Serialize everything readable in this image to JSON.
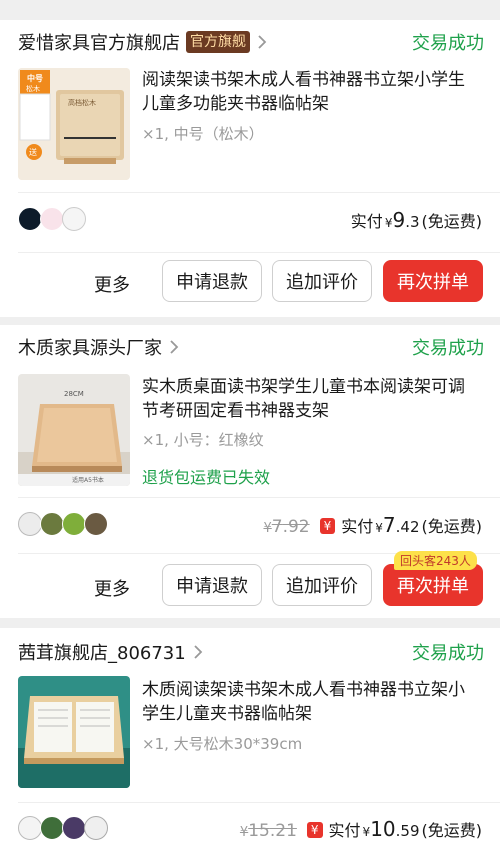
{
  "orders": [
    {
      "shop_name": "爱惜家具官方旗舰店",
      "shop_badge": "官方旗舰",
      "status": "交易成功",
      "product_title": "阅读架读书架木成人看书神器书立架小学生儿童多功能夹书器临帖架",
      "spec": "×1,  中号（松木）",
      "paid_label": "实付",
      "paid_yen": "¥",
      "paid_int": "9",
      "paid_dec": ".3",
      "paid_free": "(免运费)",
      "thumb_texts": [
        "中号",
        "松木",
        "送",
        "高档松木"
      ],
      "actions": {
        "more": "更多",
        "refund": "申请退款",
        "review": "追加评价",
        "rebuy": "再次拼单"
      }
    },
    {
      "shop_name": "木质家具源头厂家",
      "status": "交易成功",
      "product_title": "实木质桌面读书架学生儿童书本阅读架可调节考研固定看书神器支架",
      "spec": "×1,  小号：红橡纹",
      "note": "退货包运费已失效",
      "old_yen": "¥",
      "old_int": "7",
      "old_dec": ".92",
      "yen_badge": "¥",
      "paid_label": "实付",
      "paid_yen": "¥",
      "paid_int": "7",
      "paid_dec": ".42",
      "paid_free": "(免运费)",
      "thumb_texts": [
        "28CM",
        "适用A5书本"
      ],
      "tip": "回头客243人",
      "actions": {
        "more": "更多",
        "refund": "申请退款",
        "review": "追加评价",
        "rebuy": "再次拼单"
      }
    },
    {
      "shop_name": "茜茸旗舰店_806731",
      "status": "交易成功",
      "product_title": "木质阅读架读书架木成人看书神器书立架小学生儿童夹书器临帖架",
      "spec": "×1,  大号松木30*39cm",
      "old_yen": "¥",
      "old_int": "15",
      "old_dec": ".21",
      "yen_badge": "¥",
      "paid_label": "实付",
      "paid_yen": "¥",
      "paid_int": "10",
      "paid_dec": ".59",
      "paid_free": "(免运费)"
    }
  ],
  "colors": {
    "accent_red": "#e8342c",
    "success_green": "#1fa14b",
    "badge_brown": "#6b3a22",
    "tip_yellow": "#fde14a"
  }
}
